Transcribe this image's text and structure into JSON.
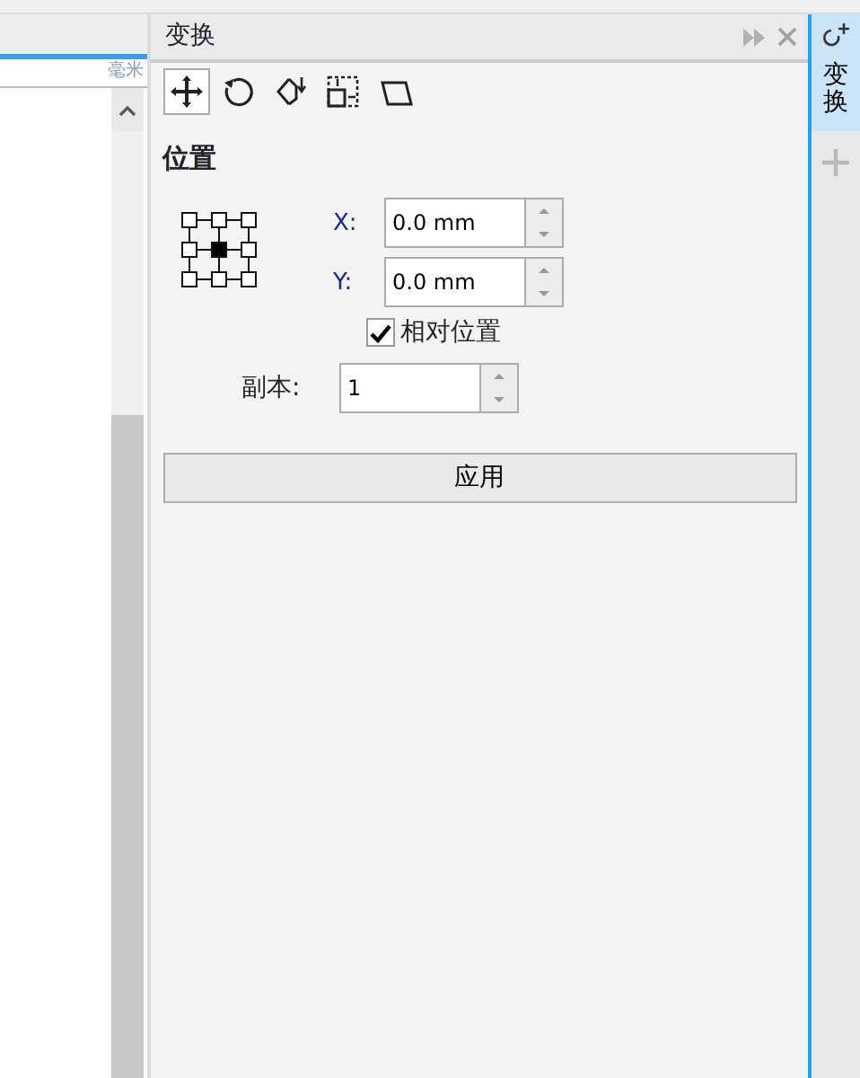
{
  "ruler": {
    "unit": "毫米"
  },
  "docker": {
    "title": "变换"
  },
  "tools": [
    {
      "kind": "position",
      "selected": true
    },
    {
      "kind": "rotate",
      "selected": false
    },
    {
      "kind": "scale",
      "selected": false
    },
    {
      "kind": "size",
      "selected": false
    },
    {
      "kind": "skew",
      "selected": false
    }
  ],
  "section_title": "位置",
  "anchors": [
    {
      "selected": false
    },
    {
      "selected": false
    },
    {
      "selected": false
    },
    {
      "selected": false
    },
    {
      "selected": true
    },
    {
      "selected": false
    },
    {
      "selected": false
    },
    {
      "selected": false
    },
    {
      "selected": false
    }
  ],
  "fields": [
    {
      "label": "X:",
      "value": "0.0 mm"
    },
    {
      "label": "Y:",
      "value": "0.0 mm"
    }
  ],
  "relative_position": {
    "label": "相对位置",
    "checked": true
  },
  "copies": {
    "label": "副本:",
    "value": "1"
  },
  "apply_button": "应用",
  "side_tabs": [
    {
      "label": "变换",
      "selected": true
    }
  ]
}
